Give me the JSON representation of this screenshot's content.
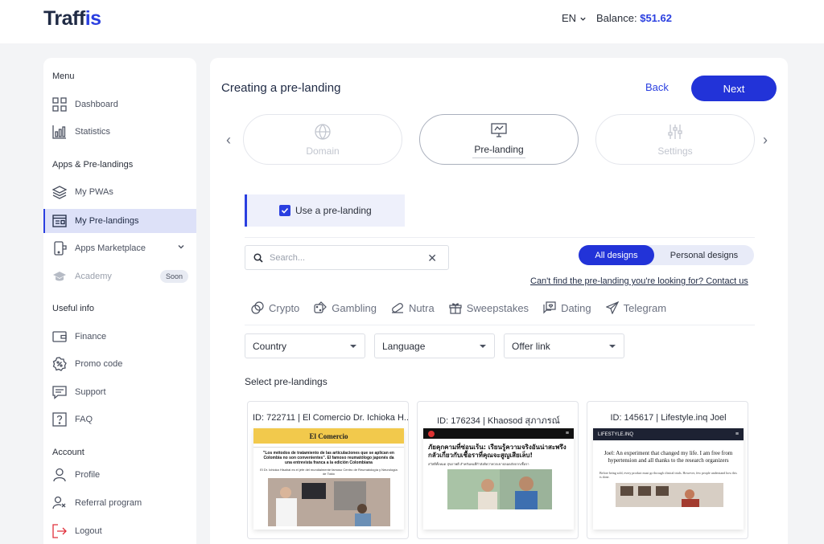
{
  "header": {
    "logo_main": "Traff",
    "logo_accent": "is",
    "lang": "EN",
    "balance_label": "Balance:",
    "balance_value": "$51.62"
  },
  "sidebar": {
    "sections": [
      "Menu",
      "Apps & Pre-landings",
      "Useful info",
      "Account"
    ],
    "items": [
      {
        "label": "Dashboard",
        "icon": "grid-icon"
      },
      {
        "label": "Statistics",
        "icon": "bar-chart-icon"
      },
      {
        "label": "My PWAs",
        "icon": "layers-icon"
      },
      {
        "label": "My Pre-landings",
        "icon": "browser-icon",
        "active": true
      },
      {
        "label": "Apps Marketplace",
        "icon": "app-store-icon"
      },
      {
        "label": "Academy",
        "icon": "graduation-cap-icon",
        "badge": "Soon"
      },
      {
        "label": "Finance",
        "icon": "wallet-icon"
      },
      {
        "label": "Promo code",
        "icon": "percent-badge-icon"
      },
      {
        "label": "Support",
        "icon": "chat-icon"
      },
      {
        "label": "FAQ",
        "icon": "question-icon"
      },
      {
        "label": "Profile",
        "icon": "user-icon"
      },
      {
        "label": "Referral program",
        "icon": "referral-icon"
      },
      {
        "label": "Logout",
        "icon": "logout-icon"
      }
    ]
  },
  "main": {
    "title": "Creating a pre-landing",
    "back_label": "Back",
    "next_label": "Next",
    "steps": [
      {
        "label": "Domain",
        "icon": "globe-icon"
      },
      {
        "label": "Pre-landing",
        "icon": "monitor-icon",
        "current": true
      },
      {
        "label": "Settings",
        "icon": "sliders-icon"
      }
    ],
    "use_prelanding_label": "Use a pre-landing",
    "use_prelanding_checked": true,
    "search_placeholder": "Search...",
    "design_tabs": [
      "All designs",
      "Personal designs"
    ],
    "design_tab_active": "All designs",
    "contact_link": "Can't find the pre-landing you're looking for? Contact us",
    "categories": [
      {
        "label": "Crypto",
        "icon": "crypto-icon"
      },
      {
        "label": "Gambling",
        "icon": "dice-icon"
      },
      {
        "label": "Nutra",
        "icon": "pill-icon"
      },
      {
        "label": "Sweepstakes",
        "icon": "gift-icon"
      },
      {
        "label": "Dating",
        "icon": "dating-icon"
      },
      {
        "label": "Telegram",
        "icon": "paper-plane-icon"
      }
    ],
    "filters": [
      "Country",
      "Language",
      "Offer link"
    ],
    "select_title": "Select pre-landings",
    "cards": [
      {
        "caption": "ID: 722711 | El Comercio Dr. Ichioka H...",
        "masthead": "El Comercio",
        "headline": "\"Los métodos de tratamiento de las articulaciones que se aplican en Colombia no son convenientes\". El famoso reumatólogo japonés da una entrevista franca a la edición Colombiana",
        "sub": "El Dr. Ichioka Hisahai es el jefe del mundialmente famoso Centro de Reumatología y Neurología de Tokio"
      },
      {
        "caption": "ID: 176234 | Khaosod สุภาภรณ์",
        "headline": "ภัยคุกคามที่ซ่อนเร้น: เรียนรู้ความจริงอันน่าสะพรึงกลัวเกี่ยวกับเชื้อราที่คุณจะสูญเสียเล็บ!",
        "sub": "สวัสดีทั้งหมด สุขภาพดี สำหรับคนที่กำลังคิดว่าพวกเขาปลอดภัยจากเชื้อรา"
      },
      {
        "caption": "ID: 145617 | Lifestyle.inq Joel",
        "masthead": "LIFESTYLE.INQ",
        "headline": "Joel: An experiment that changed my life. I am free from hypertension and all thanks to the research organizers",
        "sub": "Before being sold, every product must go through clinical trials. However, few people understand how this is done."
      }
    ]
  }
}
